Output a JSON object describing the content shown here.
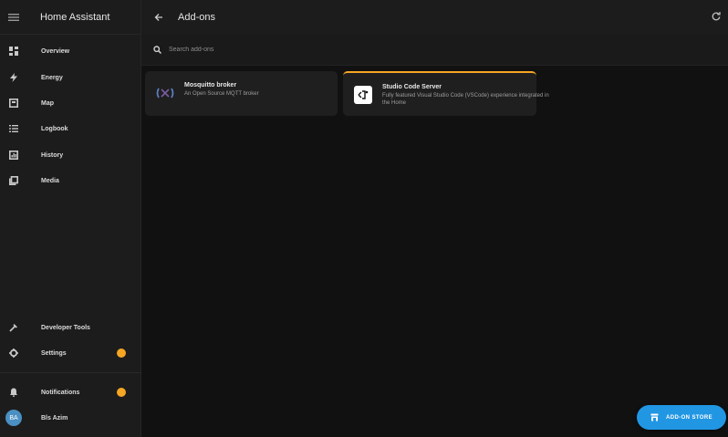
{
  "app": {
    "title": "Home Assistant"
  },
  "sidebar": {
    "items": [
      {
        "label": "Overview",
        "icon": "dashboard-icon"
      },
      {
        "label": "Energy",
        "icon": "energy-icon"
      },
      {
        "label": "Map",
        "icon": "map-icon"
      },
      {
        "label": "Logbook",
        "icon": "logbook-icon"
      },
      {
        "label": "History",
        "icon": "history-icon"
      },
      {
        "label": "Media",
        "icon": "media-icon"
      }
    ],
    "developer_tools": "Developer Tools",
    "settings": "Settings",
    "notifications": "Notifications",
    "user": {
      "initials": "BA",
      "name": "Bls Azim"
    }
  },
  "header": {
    "title": "Add-ons"
  },
  "search": {
    "placeholder": "Search add-ons"
  },
  "addons": [
    {
      "name": "Mosquitto broker",
      "description": "An Open Source MQTT broker"
    },
    {
      "name": "Studio Code Server",
      "description": "Fully featured Visual Studio Code (VSCode) experience integrated in the Home"
    }
  ],
  "store_button": {
    "label": "ADD-ON STORE"
  },
  "colors": {
    "accent": "#2196e3",
    "badge": "#f5a623",
    "sidebar_bg": "#1c1c1c",
    "page_bg": "#111111"
  }
}
